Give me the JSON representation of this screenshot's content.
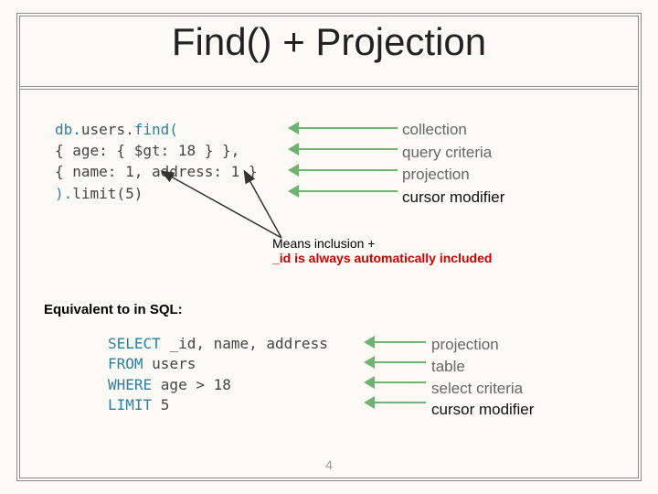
{
  "title": "Find() + Projection",
  "code_top": {
    "l1a": "db.",
    "l1b": "users.",
    "l1c": "find(",
    "l2": "    { age: { $gt: 18 } },",
    "l3": "    { name: 1, address: 1 }",
    "l4a": ").",
    "l4b": "limit(5)"
  },
  "labels_top": {
    "r1": "collection",
    "r2": "query criteria",
    "r3": "projection",
    "r4": "cursor modifier"
  },
  "inclusion": {
    "line1": "Means inclusion +",
    "line2": " _id is always automatically included"
  },
  "equiv": "Equivalent to in SQL:",
  "code_bot": {
    "l1a": "SELECT  ",
    "l1b": "_id, name, address",
    "l2a": "FROM    ",
    "l2b": "users",
    "l3a": "WHERE   ",
    "l3b": "age > 18",
    "l4a": "LIMIT   ",
    "l4b": "5"
  },
  "labels_bot": {
    "r1": "projection",
    "r2": "table",
    "r3": "select criteria",
    "r4": "cursor modifier"
  },
  "page_number": "4"
}
